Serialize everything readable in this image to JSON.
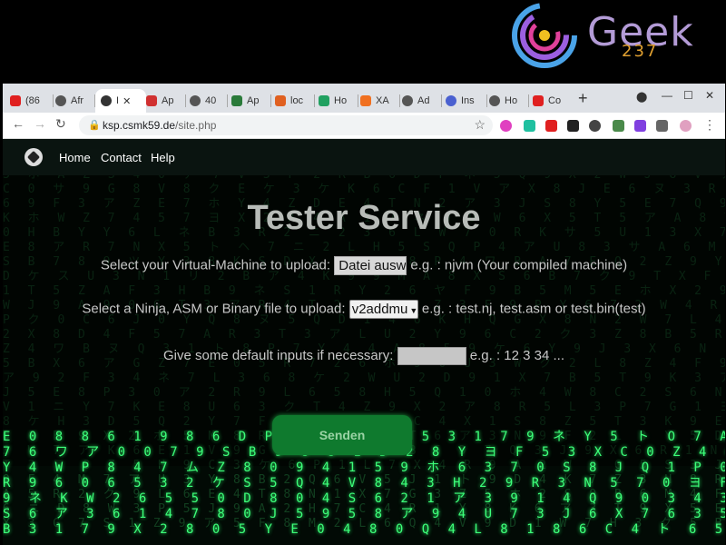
{
  "logo": {
    "text": "Geek",
    "number": "237"
  },
  "browser": {
    "tabs": [
      {
        "label": "(86",
        "color": "#e02020"
      },
      {
        "label": "Afr",
        "color": "#555555"
      },
      {
        "label": "I",
        "color": "#333333"
      },
      {
        "label": "Ap",
        "color": "#d03030"
      },
      {
        "label": "40",
        "color": "#555555"
      },
      {
        "label": "Ap",
        "color": "#2a7a3a"
      },
      {
        "label": "loc",
        "color": "#e06020"
      },
      {
        "label": "Ho",
        "color": "#20a060"
      },
      {
        "label": "XA",
        "color": "#f07020"
      },
      {
        "label": "Ad",
        "color": "#555555"
      },
      {
        "label": "Ins",
        "color": "#4a60d0"
      },
      {
        "label": "Ho",
        "color": "#555555"
      },
      {
        "label": "Co",
        "color": "#e02020"
      }
    ],
    "active_tab_index": 2,
    "new_tab": "+",
    "url_host": "ksp.csmk59.de",
    "url_path": "/site.php"
  },
  "nav": {
    "home": "Home",
    "contact": "Contact",
    "help": "Help"
  },
  "main": {
    "title": "Tester Service",
    "vm_label": "Select your Virtual-Machine to upload:",
    "vm_button": "Datei ausw",
    "vm_hint": "e.g. : njvm (Your compiled machine)",
    "file_label": "Select a Ninja, ASM or Binary file to upload:",
    "file_select": "v2addmu",
    "file_hint": "e.g. : test.nj, test.asm or test.bin(test)",
    "input_label": "Give some default inputs if necessary:",
    "input_value": "",
    "input_hint": "e.g. : 12 3 34 ...",
    "submit": "Senden"
  },
  "colors": {
    "accent": "#0f7a2e",
    "matrix": "#3dff7a"
  }
}
